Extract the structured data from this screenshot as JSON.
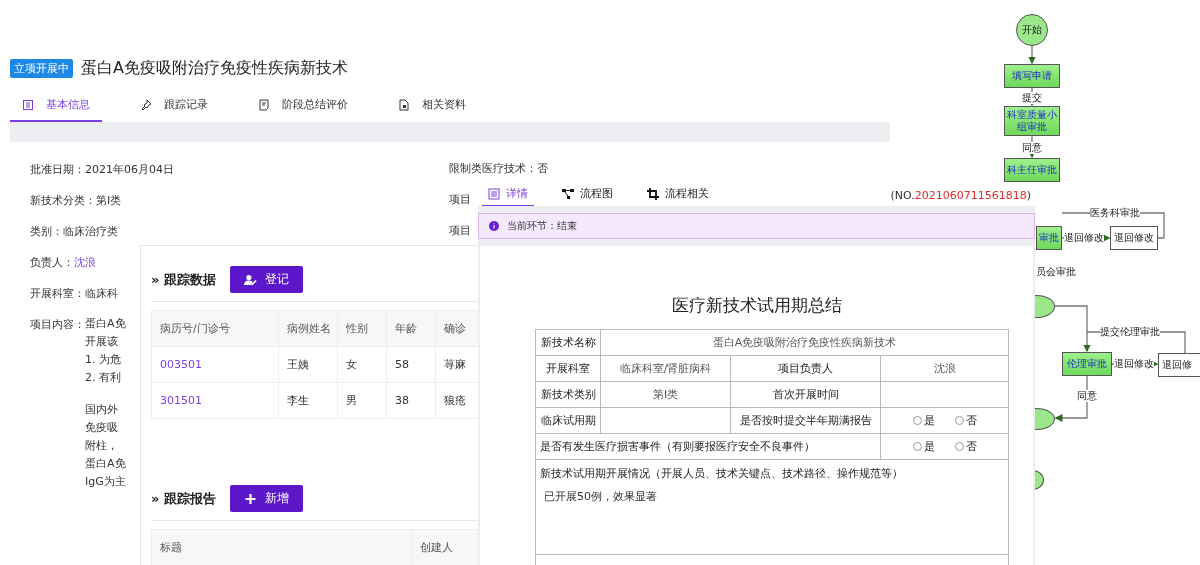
{
  "main": {
    "status_badge": "立项开展中",
    "title": "蛋白A免疫吸附治疗免疫性疾病新技术",
    "tabs": [
      {
        "label": "基本信息",
        "selected": true
      },
      {
        "label": "跟踪记录",
        "selected": false
      },
      {
        "label": "阶段总结评价",
        "selected": false
      },
      {
        "label": "相关资料",
        "selected": false
      }
    ],
    "fields_left": [
      {
        "label": "批准日期：",
        "value": "2021年06月04日",
        "kind": "text"
      },
      {
        "label": "新技术分类：",
        "value": "第Ⅰ类",
        "kind": "text"
      },
      {
        "label": "类别：",
        "value": "临床治疗类",
        "kind": "text"
      },
      {
        "label": "负责人：",
        "value": "沈浪",
        "kind": "link"
      },
      {
        "label": "开展科室：",
        "value": "临床科",
        "kind": "text"
      }
    ],
    "content_label": "项目内容：",
    "content_paragraphs": [
      [
        "蛋白A免",
        "开展该",
        "1. 为危",
        "2. 有利"
      ],
      [
        "国内外",
        "免疫吸",
        "附柱，",
        "蛋白A免",
        "IgG为主"
      ]
    ],
    "fields_right": [
      "限制类医疗技术：否",
      "项目",
      "项目"
    ]
  },
  "tracking": {
    "data_title": "» 跟踪数据",
    "register_button": "登记",
    "columns": [
      "病历号/门诊号",
      "病例姓名",
      "性别",
      "年龄",
      "确诊"
    ],
    "rows": [
      [
        {
          "text": "003501",
          "kind": "link"
        },
        {
          "text": "王姨",
          "kind": "text"
        },
        {
          "text": "女",
          "kind": "text"
        },
        {
          "text": "58",
          "kind": "text"
        },
        {
          "text": "荨麻",
          "kind": "text"
        }
      ],
      [
        {
          "text": "301501",
          "kind": "link"
        },
        {
          "text": "李生",
          "kind": "text"
        },
        {
          "text": "男",
          "kind": "text"
        },
        {
          "text": "38",
          "kind": "text"
        },
        {
          "text": "狼疮",
          "kind": "text"
        }
      ]
    ],
    "report_title": "» 跟踪报告",
    "add_button": "新增",
    "report_columns": [
      "标题",
      "创建人"
    ]
  },
  "detail": {
    "tabs": [
      {
        "label": "详情",
        "selected": true
      },
      {
        "label": "流程图",
        "selected": false
      },
      {
        "label": "流程相关",
        "selected": false
      }
    ],
    "number_prefix": "(NO.",
    "number": "2021060711561818",
    "number_suffix": ")",
    "alert": "当前环节：结束",
    "form_title": "医疗新技术试用期总结",
    "form_rows": [
      [
        {
          "kind": "label",
          "text": "新技术名称"
        },
        {
          "kind": "value",
          "text": "蛋白A免疫吸附治疗免疫性疾病新技术"
        }
      ],
      [
        {
          "kind": "label",
          "text": "开展科室"
        },
        {
          "kind": "value",
          "text": "临床科室/肾脏病科"
        },
        {
          "kind": "label",
          "text": "项目负责人"
        },
        {
          "kind": "value",
          "text": "沈浪"
        }
      ],
      [
        {
          "kind": "label",
          "text": "新技术类别"
        },
        {
          "kind": "value",
          "text": "第Ⅰ类"
        },
        {
          "kind": "label",
          "text": "首次开展时间"
        },
        {
          "kind": "value"
        }
      ],
      [
        {
          "kind": "label",
          "text": "临床试用期"
        },
        {
          "kind": "value"
        },
        {
          "kind": "label",
          "text": "是否按时提交半年期满报告"
        },
        {
          "kind": "radio",
          "options": [
            {
              "label": "是",
              "selected": false
            },
            {
              "label": "否",
              "selected": false
            }
          ]
        }
      ],
      [
        {
          "kind": "question",
          "text": "是否有发生医疗损害事件（有则要报医疗安全不良事件）"
        },
        {
          "kind": "radio",
          "options": [
            {
              "label": "是",
              "selected": false
            },
            {
              "label": "否",
              "selected": false
            }
          ]
        }
      ],
      [
        {
          "kind": "section",
          "text": "新技术试用期开展情况（开展人员、技术关键点、技术路径、操作规范等）",
          "answer": "已开展50例，效果显著"
        }
      ]
    ]
  },
  "flowchart": {
    "nodes": [
      {
        "kind": "start",
        "text": "开始"
      },
      {
        "kind": "task",
        "text": "填写申请"
      },
      {
        "kind": "task",
        "text": "科室质量小组审批"
      },
      {
        "kind": "task",
        "text": "科主任审批"
      },
      {
        "kind": "task",
        "text": "审批"
      },
      {
        "kind": "plain",
        "text": "退回修改"
      },
      {
        "kind": "end"
      },
      {
        "kind": "task",
        "text": "伦理审批"
      },
      {
        "kind": "plain",
        "text": "退回修"
      },
      {
        "kind": "end"
      },
      {
        "kind": "end"
      }
    ],
    "edge_labels": [
      "提交",
      "同意",
      "医务科审批",
      "退回修改",
      "员会审批",
      "提交伦理审批",
      "退回修改",
      "同意"
    ]
  }
}
